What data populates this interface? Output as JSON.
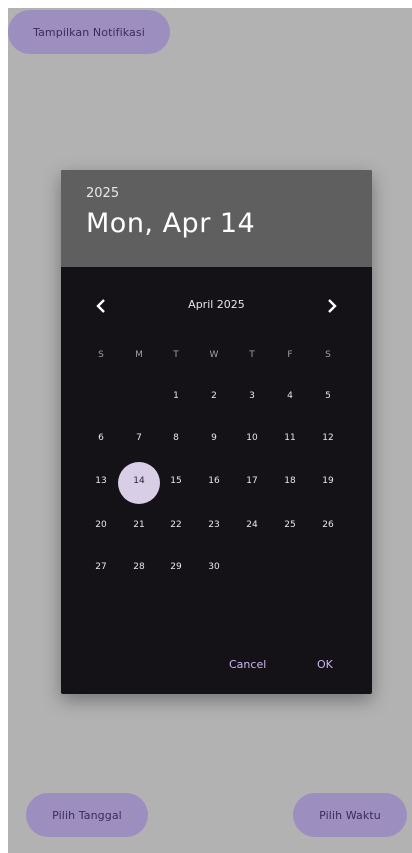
{
  "top_button": {
    "label": "Tampilkan Notifikasi"
  },
  "bottom": {
    "left_label": "Pilih Tanggal",
    "right_label": "Pilih Waktu"
  },
  "dialog": {
    "year": "2025",
    "date": "Mon, Apr 14",
    "month_label": "April 2025",
    "weekdays": [
      "S",
      "M",
      "T",
      "W",
      "T",
      "F",
      "S"
    ],
    "weeks": [
      [
        "",
        "",
        "1",
        "2",
        "3",
        "4",
        "5"
      ],
      [
        "6",
        "7",
        "8",
        "9",
        "10",
        "11",
        "12"
      ],
      [
        "13",
        "14",
        "15",
        "16",
        "17",
        "18",
        "19"
      ],
      [
        "20",
        "21",
        "22",
        "23",
        "24",
        "25",
        "26"
      ],
      [
        "27",
        "28",
        "29",
        "30",
        "",
        "",
        ""
      ]
    ],
    "selected_day": "14",
    "cancel_label": "Cancel",
    "ok_label": "OK",
    "prev_icon": "chevron-left-icon",
    "next_icon": "chevron-right-icon"
  },
  "colors": {
    "scrim": "#b2b2b2",
    "pill": "#9c8fc0",
    "dialog_bg": "#141217",
    "header_bg": "#5f5f5f",
    "selected_circle": "#d8cee6",
    "accent_text": "#c9b7f0"
  }
}
